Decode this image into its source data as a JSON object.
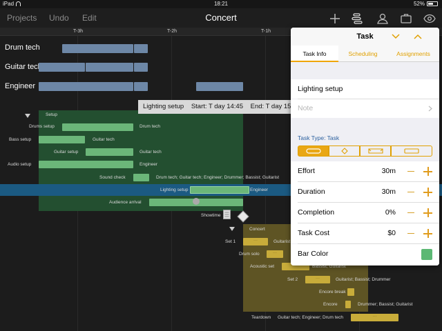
{
  "status_bar": {
    "device": "iPad",
    "time": "18:21",
    "battery": "52%"
  },
  "toolbar": {
    "projects_label": "Projects",
    "undo_label": "Undo",
    "edit_label": "Edit",
    "title": "Concert",
    "icons": [
      "plus-icon",
      "inspector-icon",
      "person-icon",
      "briefcase-icon",
      "eye-icon"
    ]
  },
  "timeline": {
    "ticks": [
      "T-3h",
      "T-2h",
      "T-1h"
    ]
  },
  "resources": [
    "Drum tech",
    "Guitar tech",
    "Engineer"
  ],
  "setup_group": {
    "group_label": "Setup",
    "tasks": [
      {
        "name": "Drums setup",
        "resources": "Drum tech"
      },
      {
        "name": "Bass setup",
        "resources": "Guitar tech"
      },
      {
        "name": "Guitar setup",
        "resources": "Guitar tech"
      },
      {
        "name": "Audio setup",
        "resources": "Engineer"
      },
      {
        "name": "Sound check",
        "resources": "Drum tech; Guitar tech; Engineer; Drummer; Bassist; Guitarist"
      },
      {
        "name": "Lighting setup",
        "resources": "Engineer"
      },
      {
        "name": "Audience arrival",
        "resources": ""
      },
      {
        "name": "Showtime",
        "resources": ""
      }
    ]
  },
  "concert_group": {
    "group_label": "Concert",
    "tasks": [
      {
        "name": "Set 1",
        "resources": "Guitarist"
      },
      {
        "name": "Drum solo",
        "resources": ""
      },
      {
        "name": "Acoustic set",
        "resources": "Bassist; Guitarist"
      },
      {
        "name": "Set 2",
        "resources": "Guitarist; Bassist; Drummer"
      },
      {
        "name": "Encore break",
        "resources": ""
      },
      {
        "name": "Encore",
        "resources": "Drummer; Bassist; Guitarist"
      },
      {
        "name": "Teardown",
        "resources": "Guitar tech; Engineer; Drum tech"
      }
    ]
  },
  "tooltip": {
    "task": "Lighting setup",
    "start": "Start: T day 14:45",
    "end": "End: T day 15:"
  },
  "popover": {
    "title": "Task",
    "tabs": [
      "Task Info",
      "Scheduling",
      "Assignments"
    ],
    "name_value": "Lighting setup",
    "note_placeholder": "Note",
    "task_type_label": "Task Type: Task",
    "fields": [
      {
        "label": "Effort",
        "value": "30m"
      },
      {
        "label": "Duration",
        "value": "30m"
      },
      {
        "label": "Completion",
        "value": "0%"
      },
      {
        "label": "Task Cost",
        "value": "$0"
      }
    ],
    "bar_color_label": "Bar Color",
    "bar_color": "#5cb874",
    "accent_color": "#e9a715"
  }
}
